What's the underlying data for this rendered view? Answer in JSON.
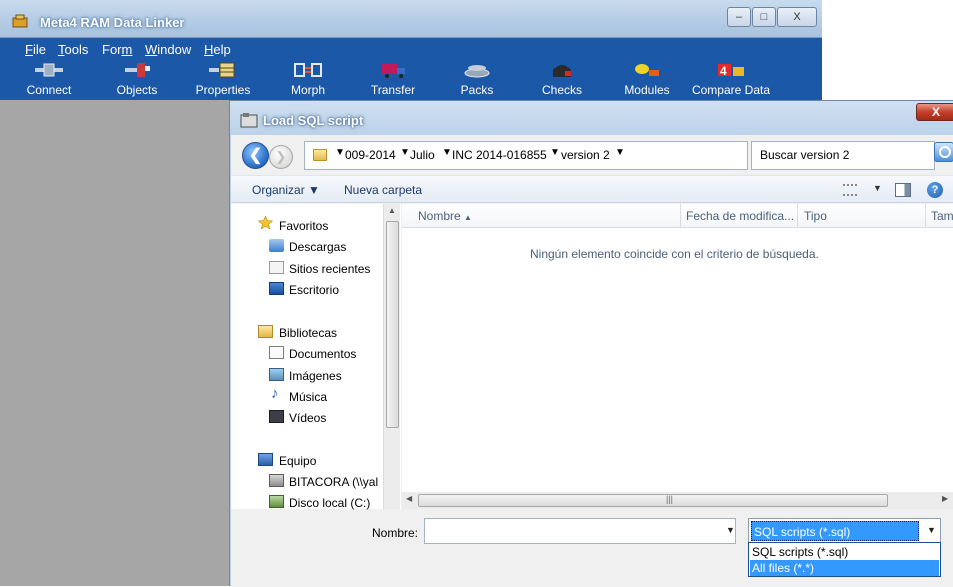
{
  "app": {
    "title": "Meta4 RAM Data Linker",
    "window_buttons": [
      "–",
      "□",
      "X"
    ],
    "menu": [
      {
        "label": "File",
        "underline": "F",
        "rest": "ile"
      },
      {
        "label": "Tools",
        "underline": "T",
        "rest": "ools"
      },
      {
        "label": "Form",
        "prefix": "For",
        "underline": "m",
        "rest": ""
      },
      {
        "label": "Window",
        "underline": "W",
        "rest": "indow"
      },
      {
        "label": "Help",
        "underline": "H",
        "rest": "elp"
      }
    ],
    "toolbar": [
      "Connect",
      "Objects",
      "Properties",
      "Morph",
      "Transfer",
      "Packs",
      "Checks",
      "Modules",
      "Compare Data"
    ]
  },
  "dialog": {
    "title": "Load SQL script",
    "close_label": "X",
    "breadcrumb": [
      "009-2014",
      "Julio",
      "INC 2014-016855",
      "version 2"
    ],
    "search_placeholder": "Buscar version 2",
    "commands": {
      "organize": "Organizar",
      "new_folder": "Nueva carpeta"
    },
    "nav_sections": [
      {
        "label": "Favoritos",
        "icon": "star-icon",
        "children": [
          {
            "label": "Descargas",
            "icon": "downloads-folder-icon"
          },
          {
            "label": "Sitios recientes",
            "icon": "recent-places-icon"
          },
          {
            "label": "Escritorio",
            "icon": "desktop-icon"
          }
        ]
      },
      {
        "label": "Bibliotecas",
        "icon": "libraries-icon",
        "children": [
          {
            "label": "Documentos",
            "icon": "documents-icon"
          },
          {
            "label": "Imágenes",
            "icon": "pictures-icon"
          },
          {
            "label": "Música",
            "icon": "music-icon"
          },
          {
            "label": "Vídeos",
            "icon": "videos-icon"
          }
        ]
      },
      {
        "label": "Equipo",
        "icon": "computer-icon",
        "children": [
          {
            "label": "BITACORA (\\\\yal",
            "icon": "network-drive-icon"
          },
          {
            "label": "Disco local (C:)",
            "icon": "local-disk-icon"
          }
        ]
      }
    ],
    "columns": [
      "Nombre",
      "Fecha de modifica...",
      "Tipo",
      "Tam"
    ],
    "empty_message": "Ningún elemento coincide con el criterio de búsqueda.",
    "filename_label": "Nombre:",
    "filename_value": "",
    "filter_selected": "SQL scripts (*.sql)",
    "filter_options": [
      "SQL scripts (*.sql)",
      "All files (*.*)"
    ],
    "filter_highlighted_index": 1
  }
}
